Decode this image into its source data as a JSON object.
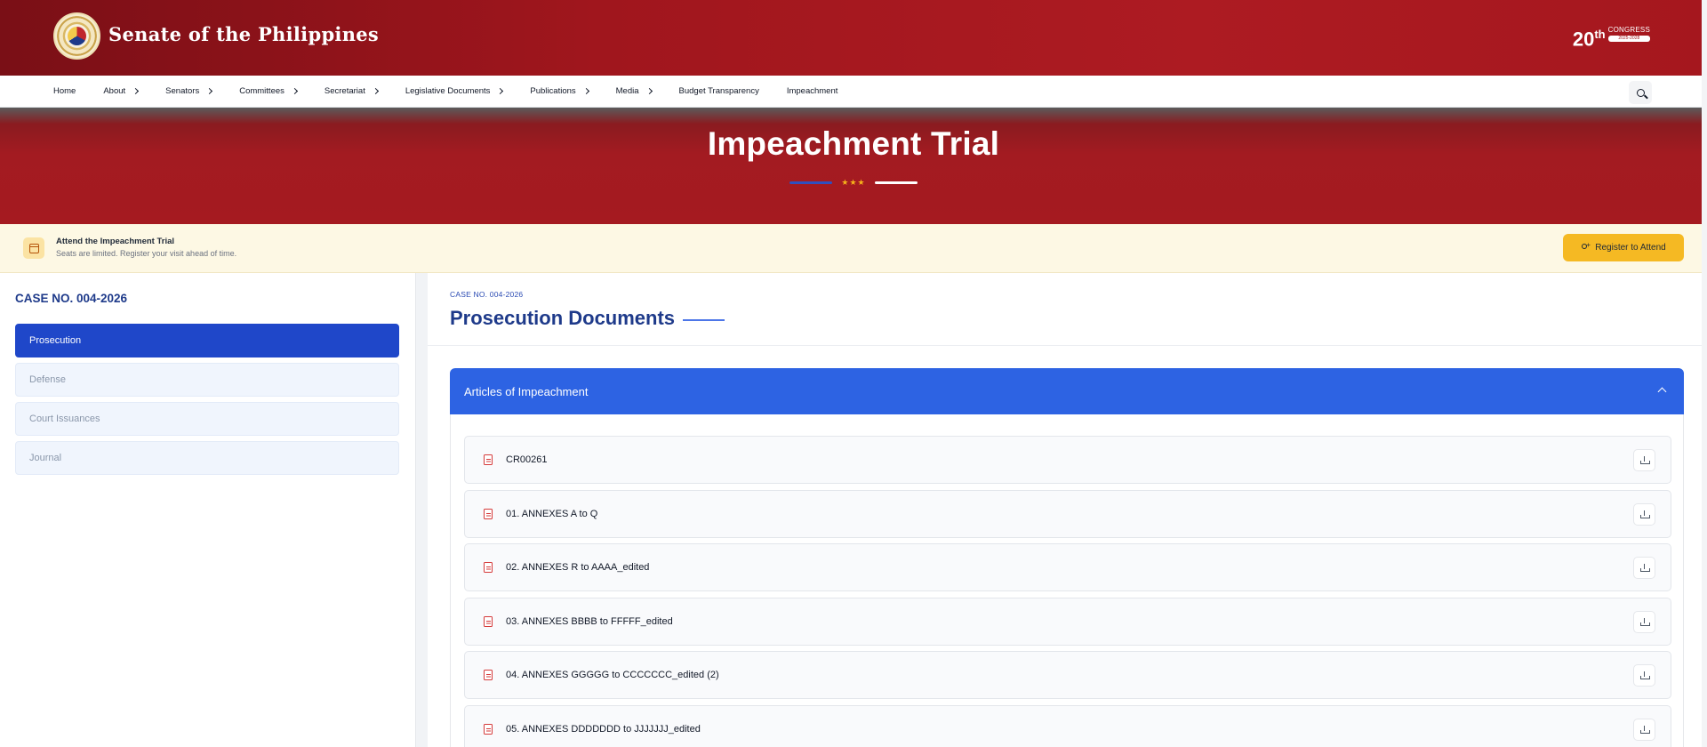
{
  "header": {
    "site_name": "Senate of the Philippines",
    "congress_number": "20",
    "congress_suffix": "th",
    "congress_word": "CONGRESS",
    "congress_years": "2025-2028"
  },
  "nav": {
    "items": [
      {
        "label": "Home",
        "has_chevron": false
      },
      {
        "label": "About",
        "has_chevron": true
      },
      {
        "label": "Senators",
        "has_chevron": true
      },
      {
        "label": "Committees",
        "has_chevron": true
      },
      {
        "label": "Secretariat",
        "has_chevron": true
      },
      {
        "label": "Legislative Documents",
        "has_chevron": true
      },
      {
        "label": "Publications",
        "has_chevron": true
      },
      {
        "label": "Media",
        "has_chevron": true
      },
      {
        "label": "Budget Transparency",
        "has_chevron": false
      },
      {
        "label": "Impeachment",
        "has_chevron": false
      }
    ],
    "search_icon": "search-icon"
  },
  "banner": {
    "title": "Impeachment Trial",
    "stars": "★★★"
  },
  "attend": {
    "title": "Attend the Impeachment Trial",
    "subtitle": "Seats are limited. Register your visit ahead of time.",
    "button_label": "Register to Attend"
  },
  "sidebar": {
    "case_no": "CASE NO. 004-2026",
    "items": [
      {
        "label": "Prosecution",
        "active": true
      },
      {
        "label": "Defense",
        "active": false
      },
      {
        "label": "Court Issuances",
        "active": false
      },
      {
        "label": "Journal",
        "active": false
      }
    ]
  },
  "main": {
    "eyebrow": "CASE NO. 004-2026",
    "title": "Prosecution Documents",
    "accordion": {
      "title": "Articles of Impeachment",
      "documents": [
        "CR00261",
        "01. ANNEXES A to Q",
        "02. ANNEXES R to AAAA_edited",
        "03. ANNEXES BBBB to FFFFF_edited",
        "04. ANNEXES GGGGG to CCCCCCC_edited (2)",
        "05. ANNEXES DDDDDDD to JJJJJJJ_edited"
      ]
    }
  },
  "colors": {
    "header_red": "#a0161d",
    "primary_blue": "#2d63e3",
    "active_blue": "#1f47c9",
    "title_navy": "#1e3a8a",
    "register_yellow": "#f5b923",
    "pdf_red": "#d53a3a"
  }
}
